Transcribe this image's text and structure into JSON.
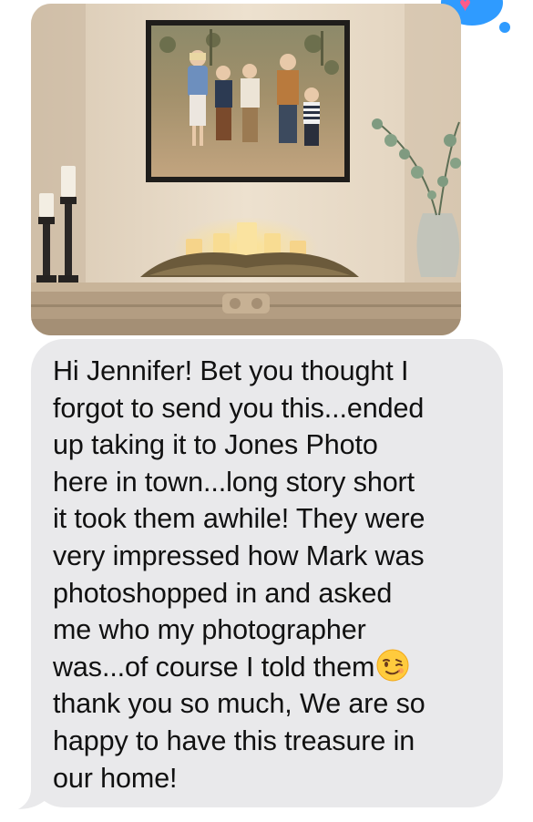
{
  "reaction": {
    "icon": "heart-tapback-icon",
    "color": "#2f9bff"
  },
  "attachment": {
    "kind": "photo",
    "description_icon": "framed-family-photo-on-mantel"
  },
  "message": {
    "lines": [
      "Hi Jennifer! Bet you thought I",
      "forgot to send you this...ended",
      "up taking it to Jones Photo",
      "here in town...long story short",
      "it took them awhile! They were",
      "very impressed how Mark was",
      "photoshopped in and asked",
      "me who my photographer",
      "was...of course I told them",
      "thank you so much, We are so",
      "happy to have this treasure in",
      "our home!"
    ],
    "emoji_after_line_9": "winking-face-emoji"
  },
  "colors": {
    "incoming_bubble": "#e9e9eb",
    "text": "#111111",
    "accent": "#2f9bff"
  }
}
